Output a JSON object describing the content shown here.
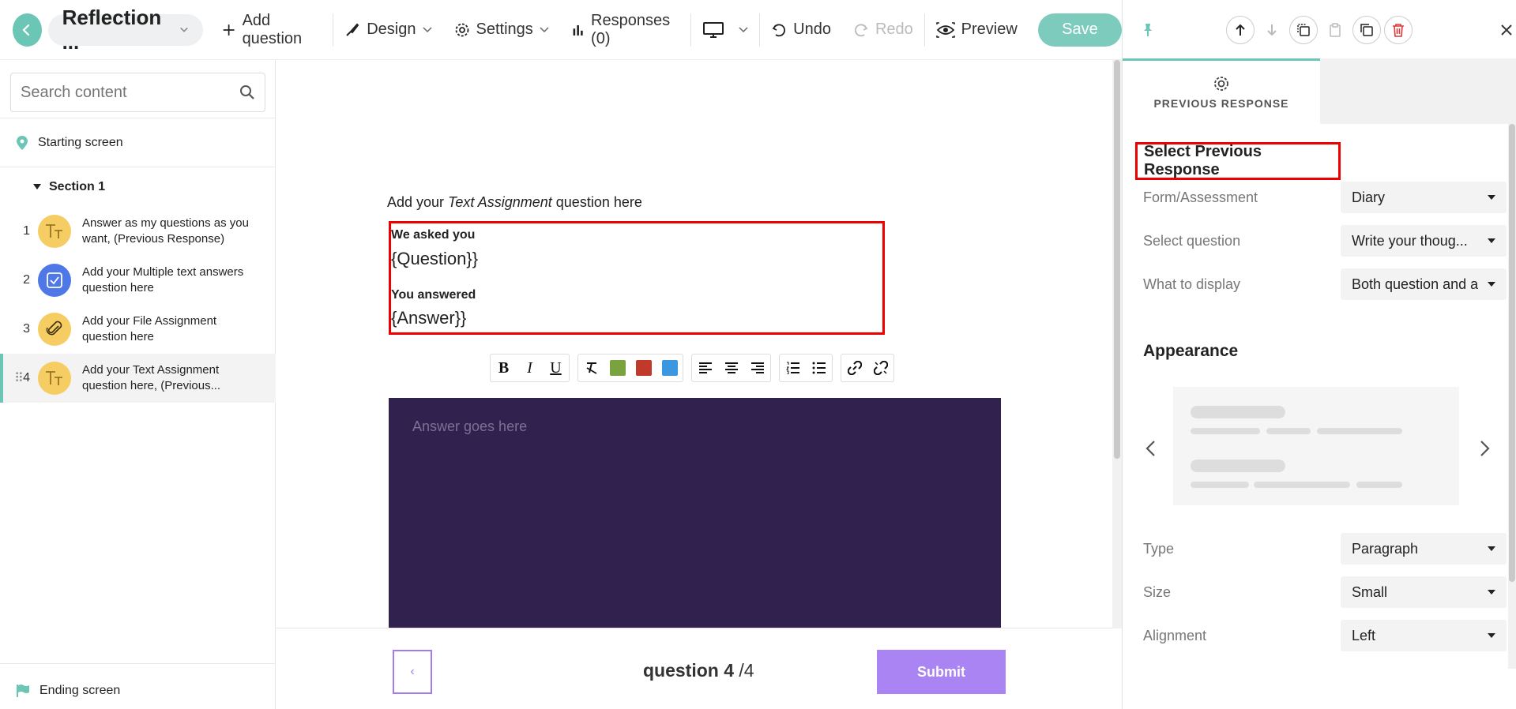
{
  "topbar": {
    "title": "Reflection ...",
    "add_question": "Add question",
    "design": "Design",
    "settings": "Settings",
    "responses": "Responses (0)",
    "undo": "Undo",
    "redo": "Redo",
    "preview": "Preview",
    "save": "Save"
  },
  "sidebar": {
    "search_placeholder": "Search content",
    "starting_screen": "Starting screen",
    "section": "Section 1",
    "items": [
      {
        "num": "1",
        "label": "Answer as my questions as you want, (Previous Response)",
        "icon": "text-icon"
      },
      {
        "num": "2",
        "label": "Add your Multiple text answers question here",
        "icon": "checkbox-icon"
      },
      {
        "num": "3",
        "label": "Add your File Assignment question here",
        "icon": "paperclip-icon"
      },
      {
        "num": "4",
        "label": "Add your Text Assignment question here, (Previous...",
        "icon": "text-icon"
      }
    ],
    "ending_screen": "Ending screen"
  },
  "canvas": {
    "question_title_prefix": "Add your ",
    "question_title_italic": "Text Assignment",
    "question_title_suffix": " question here",
    "asked": "We asked you",
    "question_token": "{Question}}",
    "answered": "You answered",
    "answer_token": "{Answer}}",
    "answer_placeholder": "Answer goes here",
    "counter_current": "question 4",
    "counter_total": "/4",
    "submit": "Submit",
    "nav_prev": "‹"
  },
  "colors": {
    "accent": "#6cc6b6",
    "answer_bg": "#30214f",
    "submit_bg": "#a984f2",
    "highlight": "#e00000",
    "swatch_green": "#7aa23f",
    "swatch_red": "#c0392b",
    "swatch_blue": "#3a97e0"
  },
  "right_panel": {
    "tab_label": "PREVIOUS RESPONSE",
    "heading": "Select Previous Response",
    "fields": [
      {
        "label": "Form/Assessment",
        "value": "Diary"
      },
      {
        "label": "Select question",
        "value": "Write your thoug..."
      },
      {
        "label": "What to display",
        "value": "Both question and a"
      }
    ],
    "appearance": "Appearance",
    "appearance_fields": [
      {
        "label": "Type",
        "value": "Paragraph"
      },
      {
        "label": "Size",
        "value": "Small"
      },
      {
        "label": "Alignment",
        "value": "Left"
      }
    ]
  }
}
